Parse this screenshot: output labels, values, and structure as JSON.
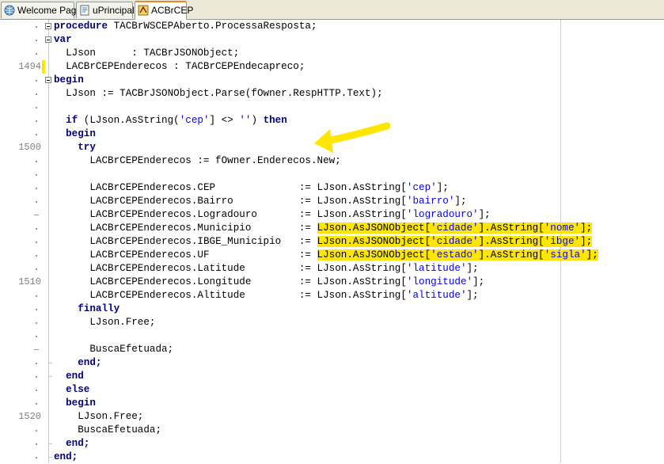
{
  "tabs": [
    {
      "label": "Welcome Page",
      "icon": "globe-icon"
    },
    {
      "label": "uPrincipal",
      "icon": "unit-file-icon"
    },
    {
      "label": "ACBrCEP",
      "icon": "acbr-unit-icon",
      "active": true
    }
  ],
  "gutter_numbers": {
    "n1494": "1494",
    "n1500": "1500",
    "n1510": "1510",
    "n1520": "1520"
  },
  "colors": {
    "keyword": "#000080",
    "string": "#0000ff",
    "highlight": "#ffe600",
    "modified_line": "#ffe600"
  },
  "code": {
    "l1_kw": "procedure",
    "l1_rest": " TACBrWSCEPAberto.ProcessaResposta;",
    "l2_kw": "var",
    "l3": "  LJson      : TACBrJSONObject;",
    "l4": "  LACBrCEPEnderecos : TACBrCEPEndecapreco;",
    "l5_kw": "begin",
    "l6": "  LJson := TACBrJSONObject.Parse(fOwner.RespHTTP.Text);",
    "l8_kw1": "  if",
    "l8_a": " (LJson.AsString(",
    "l8_s1": "'cep'",
    "l8_b": "] <> ",
    "l8_s2": "''",
    "l8_c": ") ",
    "l8_kw2": "then",
    "l9_kw": "  begin",
    "l10_kw": "    try",
    "l11": "      LACBrCEPEnderecos := fOwner.Enderecos.New;",
    "f_prefix": "      LACBrCEPEnderecos.",
    "f_assign": " := ",
    "f_call": "LJson.AsString[",
    "f_end": "];",
    "fields": {
      "cep": {
        "name": "CEP             ",
        "key": "'cep'"
      },
      "bairro": {
        "name": "Bairro          ",
        "key": "'bairro'"
      },
      "logradouro": {
        "name": "Logradouro      ",
        "key": "'logradouro'"
      },
      "latitude": {
        "name": "Latitude        ",
        "key": "'latitude'"
      },
      "longitude": {
        "name": "Longitude       ",
        "key": "'longitude'"
      },
      "altitude": {
        "name": "Altitude        ",
        "key": "'altitude'"
      }
    },
    "mun_name": "Municipio       ",
    "ibge_name": "IBGE_Municipio  ",
    "uf_name": "UF              ",
    "hl_a": "LJson.AsJSONObject[",
    "hl_b": "].AsString[",
    "hl_c": "];",
    "k_cidade": "'cidade'",
    "k_estado": "'estado'",
    "k_nome": "'nome'",
    "k_ibge": "'ibge'",
    "k_sigla": "'sigla'",
    "l_finally": "    finally",
    "l_free1": "      LJson.Free;",
    "l_busca1": "      BuscaEfetuada;",
    "l_end1": "    end;",
    "l_end2": "  end",
    "l_else": "  else",
    "l_begin2": "  begin",
    "l_free2": "    LJson.Free;",
    "l_busca2": "    BuscaEfetuada;",
    "l_end3": "  end;",
    "l_end4": "end;"
  }
}
